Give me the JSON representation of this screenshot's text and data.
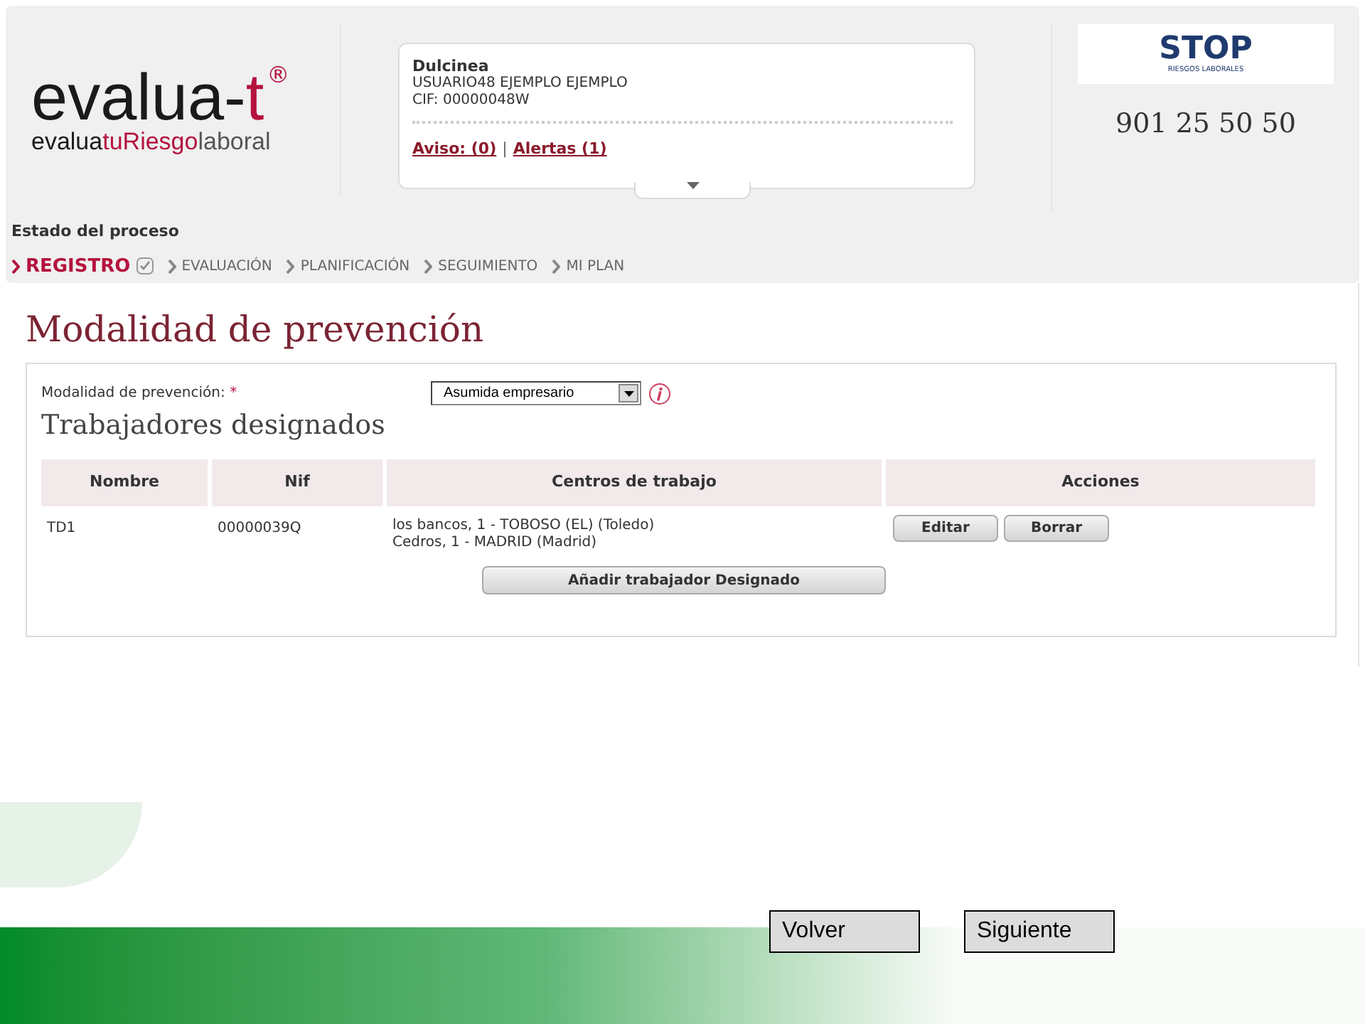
{
  "logo": {
    "parts": [
      {
        "text": "evalua-",
        "kind": "plain"
      },
      {
        "text": "t",
        "kind": "accent"
      }
    ],
    "mark": "®",
    "tagline": [
      {
        "text": "evalua",
        "kind": "plain"
      },
      {
        "text": "tuRiesgo",
        "kind": "accent"
      },
      {
        "text": "laboral",
        "kind": "muted"
      }
    ]
  },
  "user_card": {
    "name": "Dulcinea",
    "user": "USUARIO48 EJEMPLO EJEMPLO",
    "cif": "CIF: 00000048W",
    "links": [
      "Aviso: (0)",
      "Alertas (1)"
    ],
    "separator": "|"
  },
  "partner": {
    "logo": "STOP",
    "logo_sub": "RIESGOS LABORALES",
    "phone": "901 25 50 50"
  },
  "process": {
    "title": "Estado del proceso",
    "steps": [
      {
        "label": "REGISTRO",
        "selected": true,
        "checked": true
      },
      {
        "label": "EVALUACIÓN",
        "selected": false,
        "checked": false
      },
      {
        "label": "PLANIFICACIÓN",
        "selected": false,
        "checked": false
      },
      {
        "label": "SEGUIMIENTO",
        "selected": false,
        "checked": false
      },
      {
        "label": "MI PLAN",
        "selected": false,
        "checked": false
      }
    ]
  },
  "page_title": "Modalidad de prevención",
  "form": {
    "label": "Modalidad de prevención:",
    "required_mark": "*",
    "select_value": "Asumida empresario"
  },
  "section_title": "Trabajadores designados",
  "table": {
    "columns": [
      "Nombre",
      "Nif",
      "Centros de trabajo",
      "Acciones"
    ],
    "rows": [
      {
        "nombre": "TD1",
        "nif": "00000039Q",
        "centros": [
          "los bancos, 1 - TOBOSO (EL) (Toledo)",
          "Cedros, 1 - MADRID (Madrid)"
        ],
        "actions": [
          "Editar",
          "Borrar"
        ]
      }
    ]
  },
  "add_button": "Añadir trabajador Designado",
  "nav_buttons": [
    "Volver",
    "Siguiente"
  ]
}
